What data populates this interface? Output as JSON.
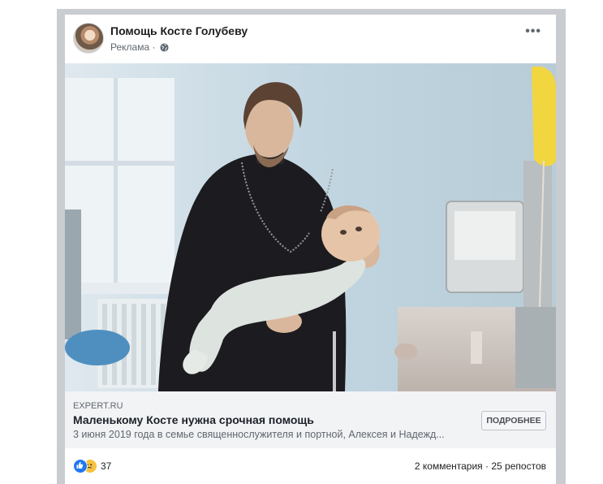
{
  "post": {
    "page_name": "Помощь Косте Голубеву",
    "sponsored_label": "Реклама",
    "separator": "·",
    "more_menu": "•••"
  },
  "link_preview": {
    "domain": "EXPERT.RU",
    "title": "Маленькому Косте нужна срочная помощь",
    "description": "3 июня 2019 года в семье священнослужителя и портной, Алексея и Надежд...",
    "cta_label": "ПОДРОБНЕЕ"
  },
  "engagement": {
    "reaction_count": "37",
    "reactions": [
      "like-icon",
      "sad-icon"
    ],
    "comments": "2 комментария",
    "dot": "·",
    "shares": "25 репостов"
  },
  "colors": {
    "page_background": "#ffffff",
    "frame": "#c9ccd1",
    "link_box": "#f2f3f5",
    "like_blue": "#2078f4",
    "sad_yellow": "#f7c23d"
  }
}
